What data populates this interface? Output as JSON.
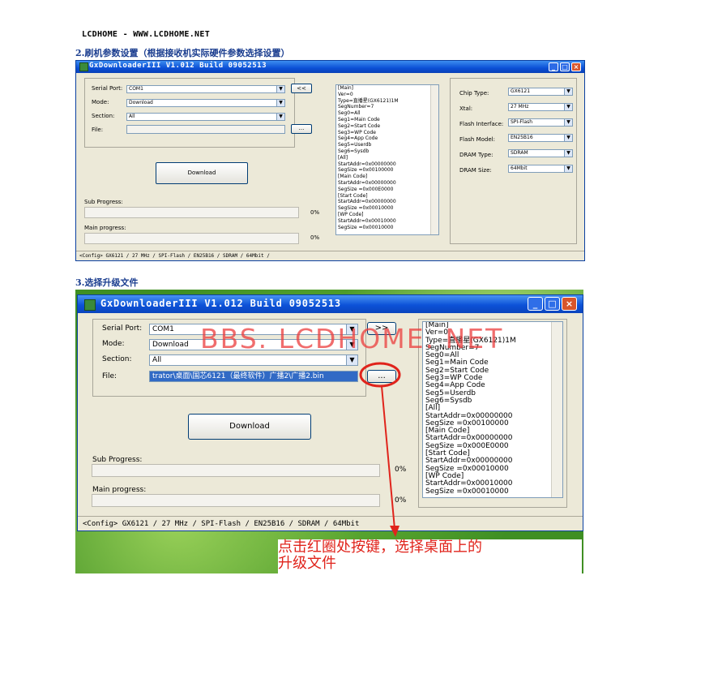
{
  "doc": {
    "header": "LCDHOME - WWW.LCDHOME.NET",
    "step2_title": "2.刷机参数设置（根据接收机实际硬件参数选择设置）",
    "step3_title": "3.选择升级文件"
  },
  "app": {
    "title": "GxDownloaderIII V1.012 Build 09052513",
    "serial_port_label": "Serial Port:",
    "serial_port_value": "COM1",
    "mode_label": "Mode:",
    "mode_value": "Download",
    "section_label": "Section:",
    "section_value": "All",
    "file_label": "File:",
    "file_value_2": "trator\\桌面\\国芯6121（最终软件）广播2\\广播2.bin",
    "browse_label": "...",
    "toggle_label_1": "<<",
    "toggle_label_2": ">>",
    "download_label": "Download",
    "sub_progress_label": "Sub Progress:",
    "sub_progress_pct": "0%",
    "main_progress_label": "Main progress:",
    "main_progress_pct": "0%",
    "status_bar": "<Config>  GX6121 / 27 MHz / SPI-Flash / EN25B16 / SDRAM / 64Mbit /",
    "status_bar_2": "<Config>  GX6121 / 27 MHz / SPI-Flash / EN25B16 / SDRAM / 64Mbit",
    "config_text": [
      "[Main]",
      "Ver=0",
      "Type=直播星(GX6121)1M",
      "SegNumber=7",
      "Seg0=All",
      "Seg1=Main Code",
      "Seg2=Start Code",
      "Seg3=WP Code",
      "Seg4=App Code",
      "Seg5=Userdb",
      "Seg6=Sysdb",
      "[All]",
      "StartAddr=0x00000000",
      "SegSize  =0x00100000",
      "[Main Code]",
      "StartAddr=0x00000000",
      "SegSize  =0x000E0000",
      "[Start Code]",
      "StartAddr=0x00000000",
      "SegSize  =0x00010000",
      "[WP Code]",
      "StartAddr=0x00010000",
      "SegSize  =0x00010000"
    ],
    "hw": {
      "chip_type_label": "Chip Type:",
      "chip_type_value": "GX6121",
      "xtal_label": "Xtal:",
      "xtal_value": "27 MHz",
      "flash_interface_label": "Flash Interface:",
      "flash_interface_value": "SPI-Flash",
      "flash_model_label": "Flash Model:",
      "flash_model_value": "EN25B16",
      "dram_type_label": "DRAM Type:",
      "dram_type_value": "SDRAM",
      "dram_size_label": "DRAM Size:",
      "dram_size_value": "64Mbit"
    }
  },
  "overlay": {
    "watermark": "BBS. LCDHOME. NET",
    "callout_line1": "点击红圈处按键，选择桌面上的",
    "callout_line2": "升级文件",
    "accent_color": "#e0241c"
  }
}
